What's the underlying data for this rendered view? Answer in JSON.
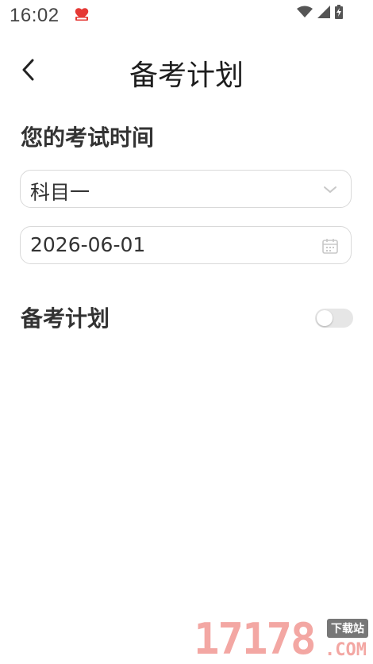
{
  "status_bar": {
    "time": "16:02",
    "app_icon": "red-heart-app-icon",
    "icons": [
      "wifi-icon",
      "signal-icon",
      "battery-charging-icon"
    ]
  },
  "header": {
    "title": "备考计划",
    "back_icon": "chevron-left-icon"
  },
  "exam_section": {
    "title": "您的考试时间",
    "subject_select": {
      "value": "科目一",
      "icon": "chevron-down-icon"
    },
    "date_field": {
      "value": "2026-06-01",
      "icon": "calendar-icon"
    }
  },
  "plan_section": {
    "title": "备考计划",
    "toggle_on": false
  },
  "watermark": {
    "digits": "17178",
    "tag": "下载站",
    "domain": ".COM"
  },
  "colors": {
    "toggle_off": "#e6e6e6",
    "border": "#d9d9d9",
    "watermark": "#f3a7a3"
  }
}
